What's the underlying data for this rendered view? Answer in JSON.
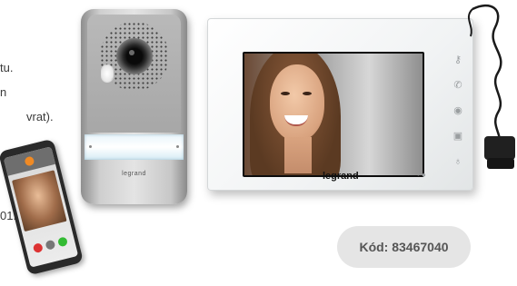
{
  "left_text": {
    "line1": "tu.",
    "line2": "n",
    "line3": "vrat).",
    "line4": "01."
  },
  "door_station": {
    "brand": "legrand"
  },
  "monitor": {
    "brand": "legrand",
    "icons": [
      "key-icon",
      "phone-icon",
      "eye-icon",
      "camera-icon",
      "bulb-icon"
    ]
  },
  "product_code": {
    "label": "Kód: 83467040"
  }
}
